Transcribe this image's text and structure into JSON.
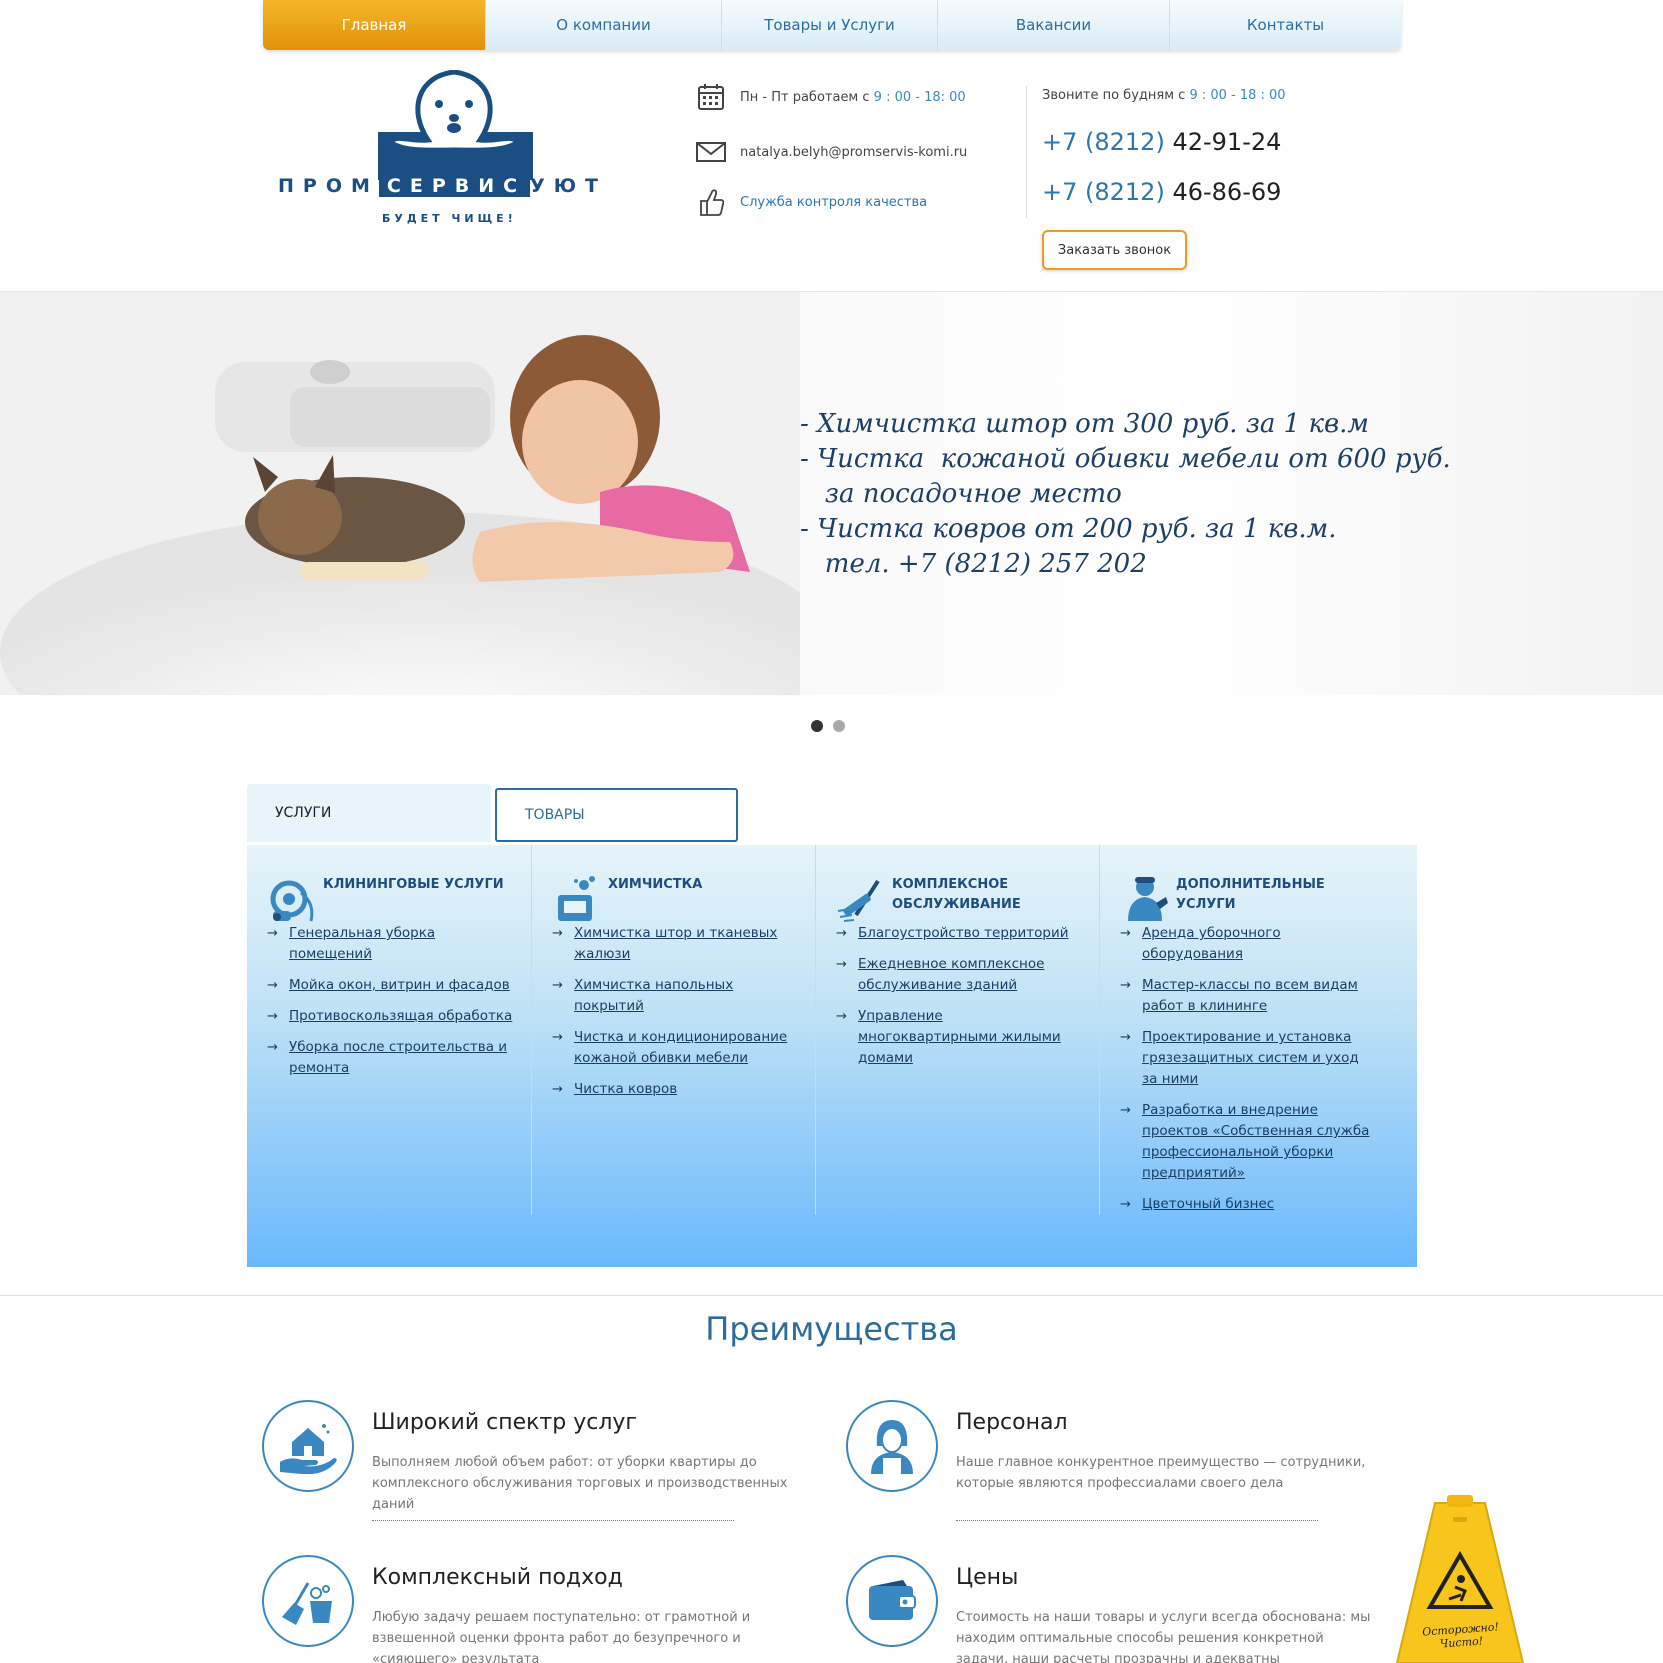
{
  "nav": {
    "items": [
      {
        "label": "Главная",
        "active": true
      },
      {
        "label": "О компании"
      },
      {
        "label": "Товары и Услуги"
      },
      {
        "label": "Вакансии"
      },
      {
        "label": "Контакты"
      }
    ]
  },
  "logo": {
    "name_left": "ПРОМ",
    "name_mid": "СЕРВИС",
    "name_right": "УЮТ",
    "slogan": "БУДЕТ ЧИЩЕ!"
  },
  "header": {
    "hours_prefix": "Пн - Пт работаем с",
    "hours_value": "9 : 00 - 18: 00",
    "email": "natalya.belyh@promservis-komi.ru",
    "quality_link": "Служба контроля качества",
    "call_prefix": "Звоните по будням с",
    "call_hours": "9 : 00 - 18 : 00",
    "phones": [
      {
        "code": "+7 (8212)",
        "number": "42-91-24"
      },
      {
        "code": "+7 (8212)",
        "number": "46-86-69"
      }
    ],
    "callback_label": "Заказать звонок"
  },
  "banner": {
    "lines": [
      "- Химчистка штор от 300 руб. за 1 кв.м",
      "- Чистка  кожаной обивки мебели от 600 руб.",
      "   за посадочное место",
      "- Чистка ковров от 200 руб. за 1 кв.м.",
      "   тел. +7 (8212) 257 202"
    ],
    "slides": 2,
    "active_slide": 1
  },
  "tabs": {
    "services": "УСЛУГИ",
    "goods": "ТОВАРЫ"
  },
  "services": {
    "columns": [
      {
        "icon": "vacuum-cleaner-icon",
        "title": "КЛИНИНГОВЫЕ УСЛУГИ",
        "items": [
          "Генеральная уборка помещений",
          "Мойка окон, витрин и фасадов",
          "Противоскользящая обработка",
          "Уборка после строительства и ремонта"
        ]
      },
      {
        "icon": "dry-cleaning-icon",
        "title": "ХИМЧИСТКА",
        "items": [
          "Химчистка штор и тканевых жалюзи",
          "Химчистка напольных покрытий",
          "Чистка и кондиционирование кожаной обивки мебели",
          "Чистка ковров"
        ]
      },
      {
        "icon": "squeegee-icon",
        "title": "КОМПЛЕКСНОЕ ОБСЛУЖИВАНИЕ",
        "items": [
          "Благоустройство территорий",
          "Ежедневное комплексное обслуживание зданий",
          "Управление многоквартирными жилыми домами"
        ]
      },
      {
        "icon": "worker-icon",
        "title": "ДОПОЛНИТЕЛЬНЫЕ УСЛУГИ",
        "items": [
          "Аренда уборочного оборудования",
          "Мастер-классы по всем видам работ в клининге",
          "Проектирование и установка грязезащитных систем и уход за ними",
          "Разработка и внедрение проектов «Собственная служба профессиональной уборки предприятий»",
          "Цветочный бизнес"
        ]
      }
    ]
  },
  "advantages": {
    "title": "Преимущества",
    "items": [
      {
        "icon": "house-hand-icon",
        "title": "Широкий спектр услуг",
        "text": "Выполняем любой объем работ: от уборки квартиры до комплексного обслуживания торговых и производственных даний"
      },
      {
        "icon": "person-icon",
        "title": "Персонал",
        "text": "Наше главное конкурентное преимущество — сотрудники, которые являются профессиалами своего дела"
      },
      {
        "icon": "broom-bucket-icon",
        "title": "Комплексный подход",
        "text": "Любую задачу решаем поступательно: от грамотной и взвешенной оценки фронта работ до безупречного и «сияющего» результата"
      },
      {
        "icon": "wallet-icon",
        "title": "Цены",
        "text": "Стоимость на наши товары и услуги всегда обоснована: мы находим оптимальные способы решения конкретной задачи, наши расчеты прозрачны и адекватны"
      }
    ]
  },
  "sign": {
    "text1": "Осторожно!",
    "text2": "Чисто!"
  },
  "colors": {
    "accent": "#2d76b1",
    "orange": "#e0920a",
    "dark_blue": "#1b4f84"
  }
}
